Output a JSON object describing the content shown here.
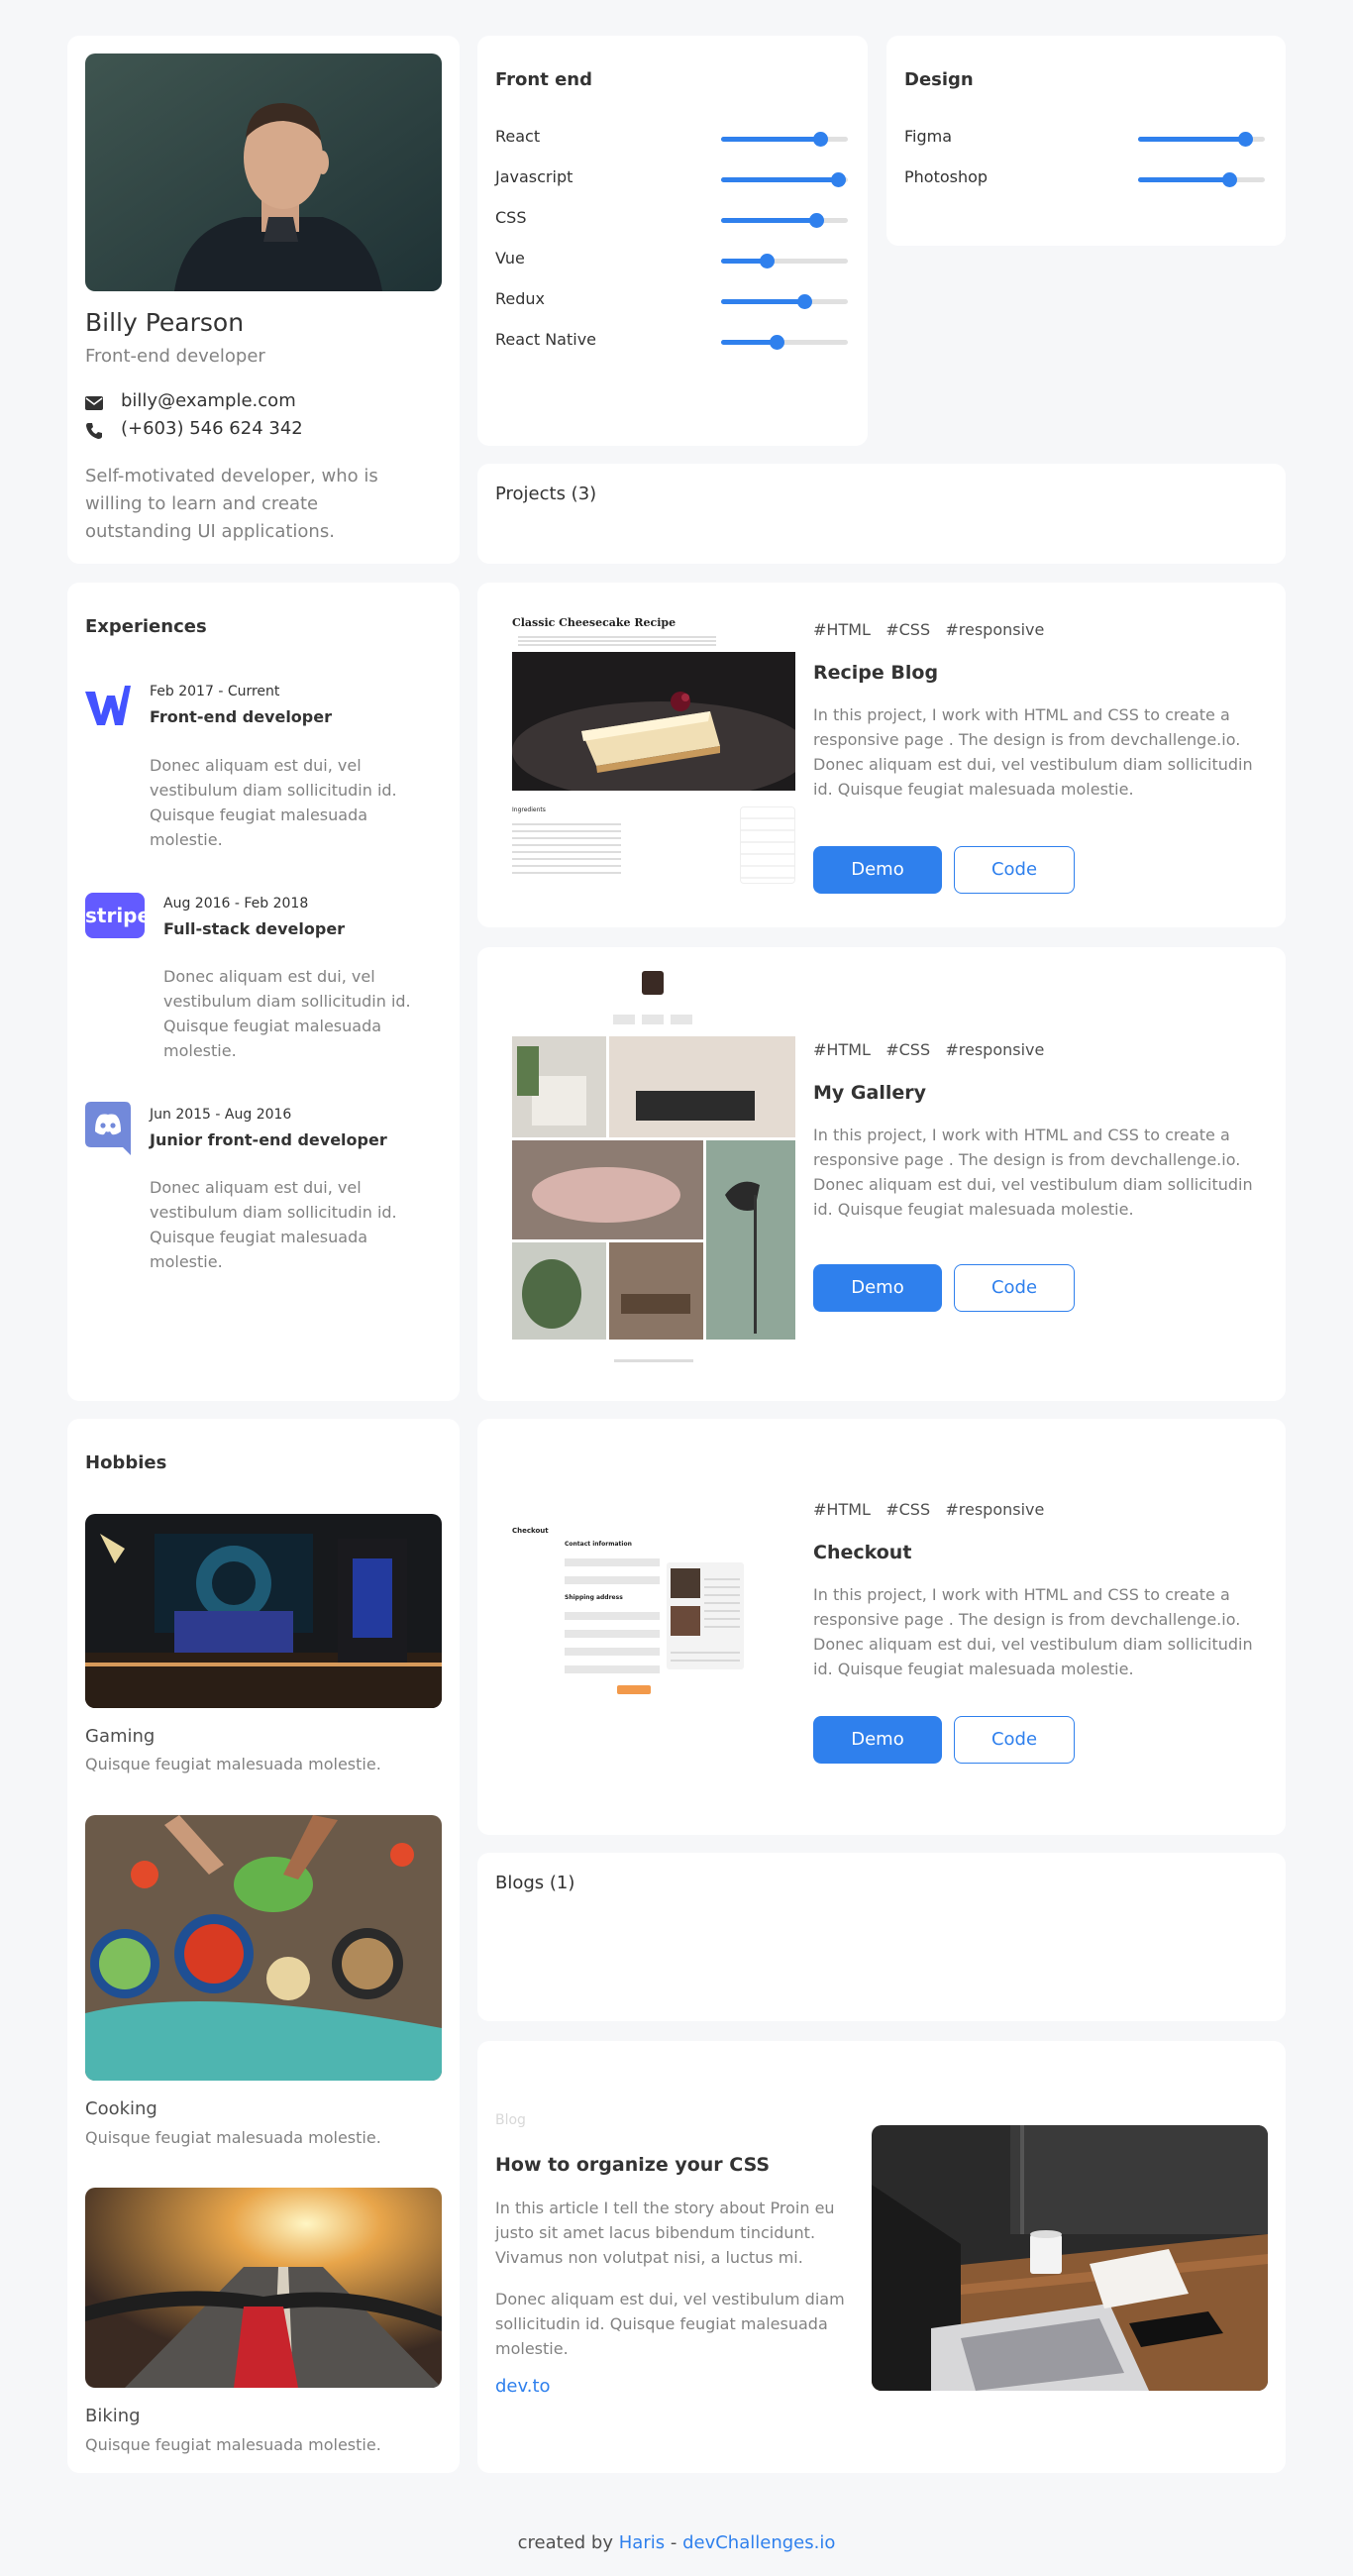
{
  "profile": {
    "name": "Billy Pearson",
    "role": "Front-end developer",
    "email": "billy@example.com",
    "phone": "(+603) 546 624 342",
    "bio": "Self-motivated developer, who is willing to learn and create outstanding UI applications."
  },
  "frontend": {
    "title": "Front end",
    "skills": [
      {
        "name": "React",
        "level": 0.78
      },
      {
        "name": "Javascript",
        "level": 0.92
      },
      {
        "name": "CSS",
        "level": 0.75
      },
      {
        "name": "Vue",
        "level": 0.36
      },
      {
        "name": "Redux",
        "level": 0.66
      },
      {
        "name": "React Native",
        "level": 0.44
      }
    ]
  },
  "design": {
    "title": "Design",
    "skills": [
      {
        "name": "Figma",
        "level": 0.84
      },
      {
        "name": "Photoshop",
        "level": 0.72
      }
    ]
  },
  "projects_header": "Projects (3)",
  "experiences": {
    "title": "Experiences",
    "items": [
      {
        "date": "Feb 2017 - Current",
        "title": "Front-end developer",
        "desc": "Donec aliquam est dui, vel vestibulum diam sollicitudin id. Quisque feugiat malesuada molestie.",
        "logo": "webflow-logo-icon"
      },
      {
        "date": "Aug 2016 - Feb 2018",
        "title": "Full-stack developer",
        "desc": "Donec aliquam est dui, vel vestibulum diam sollicitudin id. Quisque feugiat malesuada molestie.",
        "logo": "stripe-logo-icon",
        "logo_text": "stripe"
      },
      {
        "date": "Jun 2015 - Aug 2016",
        "title": "Junior front-end developer",
        "desc": "Donec aliquam est dui, vel vestibulum diam sollicitudin id. Quisque feugiat malesuada molestie.",
        "logo": "discord-logo-icon"
      }
    ]
  },
  "projects": [
    {
      "tags": [
        "#HTML",
        "#CSS",
        "#responsive"
      ],
      "title": "Recipe Blog",
      "desc": "In this project, I work with HTML and CSS to create a responsive page . The design is from devchallenge.io. Donec aliquam est dui, vel vestibulum diam sollicitudin id. Quisque feugiat malesuada molestie.",
      "demo": "Demo",
      "code": "Code",
      "thumb": {
        "heading": "Classic Cheesecake Recipe",
        "section": "Ingredients"
      }
    },
    {
      "tags": [
        "#HTML",
        "#CSS",
        "#responsive"
      ],
      "title": "My Gallery",
      "desc": "In this project, I work with HTML and CSS to create a responsive page . The design is from devchallenge.io. Donec aliquam est dui, vel vestibulum diam sollicitudin id. Quisque feugiat malesuada molestie.",
      "demo": "Demo",
      "code": "Code"
    },
    {
      "tags": [
        "#HTML",
        "#CSS",
        "#responsive"
      ],
      "title": "Checkout",
      "desc": "In this project, I work with HTML and CSS to create a responsive page . The design is from devchallenge.io. Donec aliquam est dui, vel vestibulum diam sollicitudin id. Quisque feugiat malesuada molestie.",
      "demo": "Demo",
      "code": "Code",
      "thumb": {
        "heading": "Checkout",
        "contact": "Contact information",
        "shipping": "Shipping address"
      }
    }
  ],
  "hobbies": {
    "title": "Hobbies",
    "items": [
      {
        "name": "Gaming",
        "desc": "Quisque feugiat malesuada molestie."
      },
      {
        "name": "Cooking",
        "desc": "Quisque feugiat malesuada molestie."
      },
      {
        "name": "Biking",
        "desc": "Quisque feugiat malesuada molestie."
      }
    ]
  },
  "blogs_header": "Blogs (1)",
  "blog": {
    "label": "Blog",
    "title": "How to organize your CSS",
    "p1": "In this article I tell the story about Proin eu justo sit amet lacus bibendum tincidunt. Vivamus non volutpat nisi, a luctus mi.",
    "p2": "Donec aliquam est dui, vel vestibulum diam sollicitudin id. Quisque feugiat malesuada molestie.",
    "link": "dev.to"
  },
  "footer": {
    "prefix": "created by",
    "author": "Haris",
    "sep": "-",
    "site": "devChallenges.io"
  },
  "colors": {
    "accent": "#2f80ed",
    "background": "#f6f7f9",
    "card": "#ffffff"
  }
}
